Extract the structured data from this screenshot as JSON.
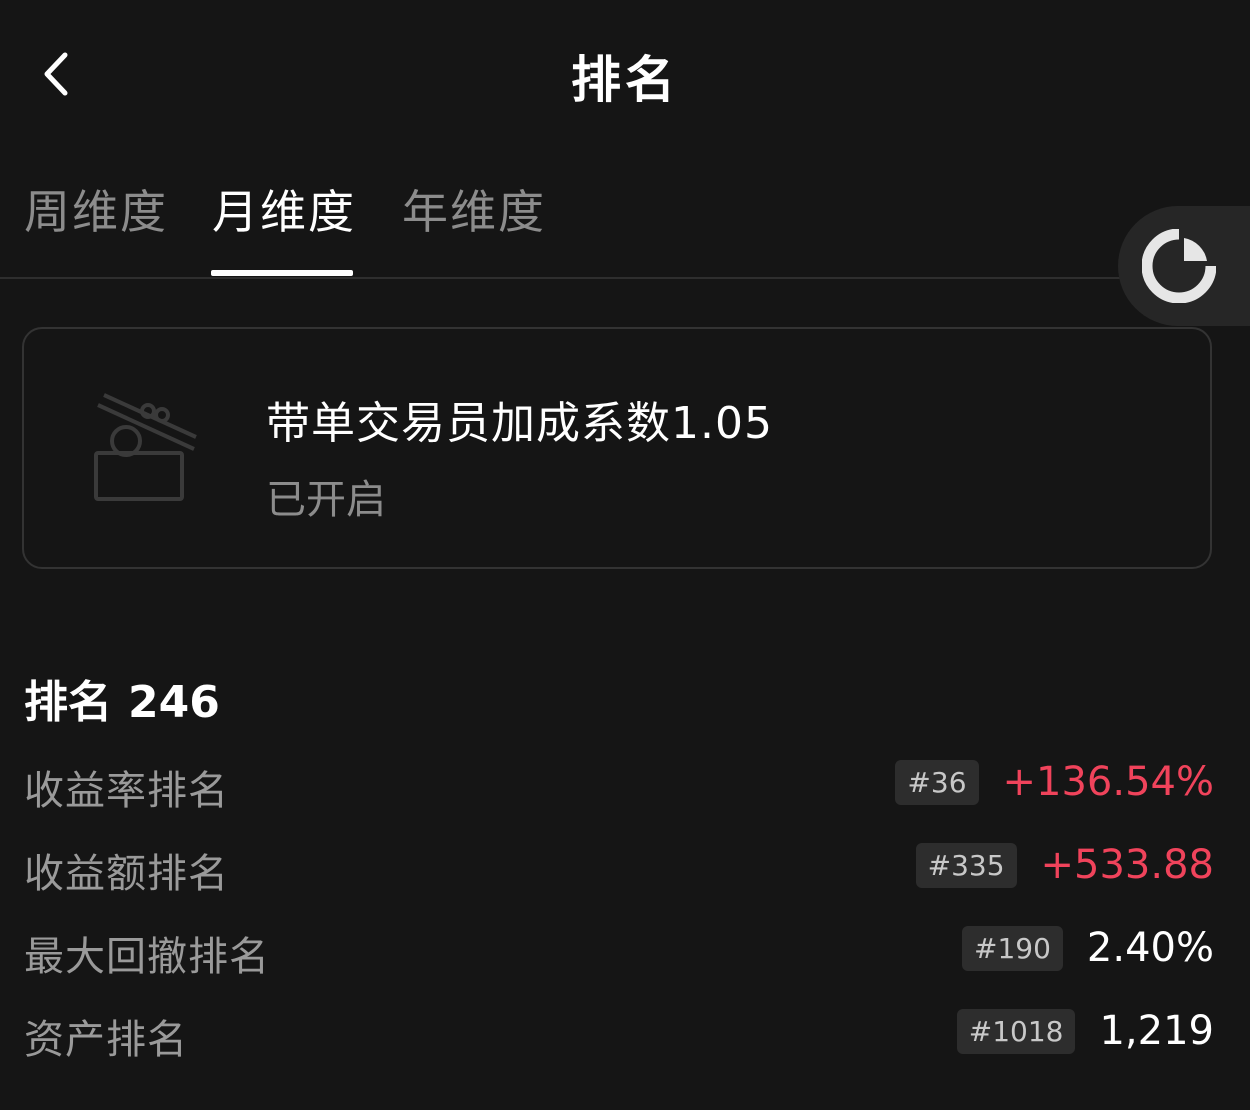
{
  "header": {
    "title": "排名",
    "back_icon": "chevron-left-icon"
  },
  "tabs": [
    {
      "label": "周维度",
      "active": false
    },
    {
      "label": "月维度",
      "active": true
    },
    {
      "label": "年维度",
      "active": false
    }
  ],
  "floating_button": {
    "icon": "pie-refresh-icon"
  },
  "bonus_card": {
    "icon": "gift-box-icon",
    "title": "带单交易员加成系数1.05",
    "status": "已开启"
  },
  "ranking": {
    "label": "排名",
    "value": "246",
    "rows": [
      {
        "label": "收益率排名",
        "badge": "#36",
        "value": "+136.54%",
        "tone": "positive"
      },
      {
        "label": "收益额排名",
        "badge": "#335",
        "value": "+533.88",
        "tone": "positive"
      },
      {
        "label": "最大回撤排名",
        "badge": "#190",
        "value": "2.40%",
        "tone": "neutral"
      },
      {
        "label": "资产排名",
        "badge": "#1018",
        "value": "1,219",
        "tone": "neutral"
      }
    ]
  },
  "colors": {
    "background": "#151515",
    "positive": "#f0435b",
    "muted": "#8c8c8c"
  }
}
